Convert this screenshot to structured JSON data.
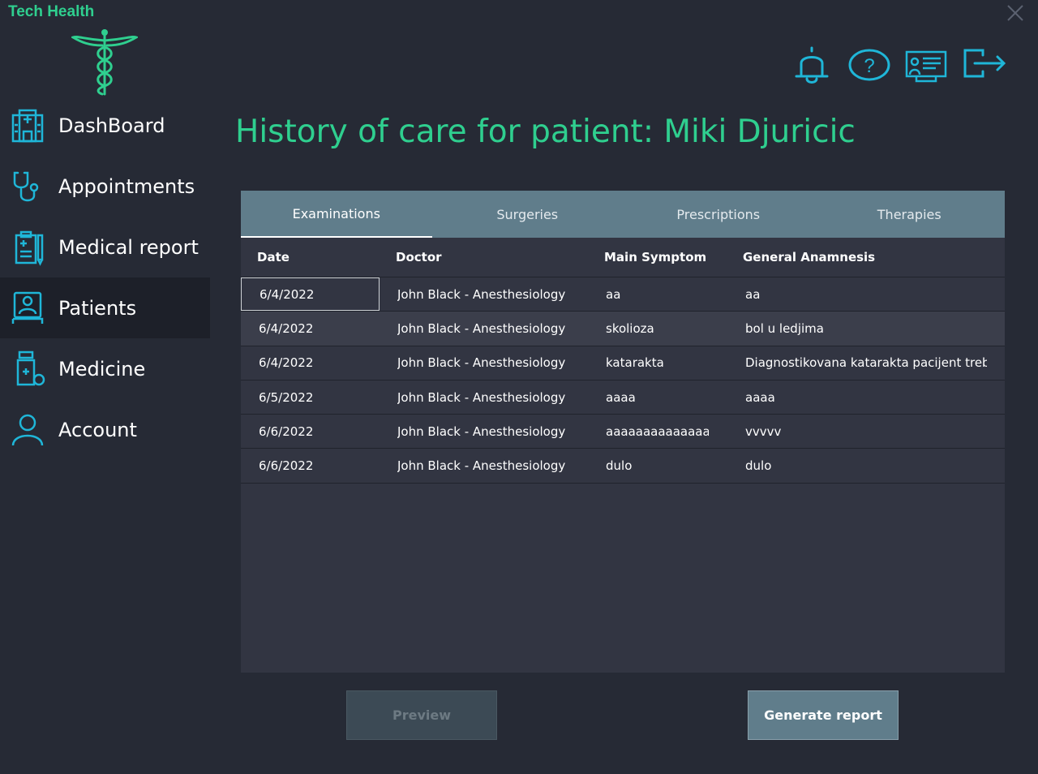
{
  "app": {
    "title": "Tech Health"
  },
  "sidebar": {
    "items": [
      {
        "label": "DashBoard",
        "icon": "hospital-icon",
        "active": false
      },
      {
        "label": "Appointments",
        "icon": "stethoscope-icon",
        "active": false
      },
      {
        "label": "Medical report",
        "icon": "clipboard-icon",
        "active": false
      },
      {
        "label": "Patients",
        "icon": "patient-icon",
        "active": true
      },
      {
        "label": "Medicine",
        "icon": "medicine-bottle-icon",
        "active": false
      },
      {
        "label": "Account",
        "icon": "user-icon",
        "active": false
      }
    ]
  },
  "toolbar": {
    "icons": [
      "bell-icon",
      "help-icon",
      "presentation-icon",
      "logout-icon"
    ]
  },
  "page": {
    "title": "History of care for patient: Miki Djuricic"
  },
  "tabs": [
    {
      "label": "Examinations",
      "active": true
    },
    {
      "label": "Surgeries",
      "active": false
    },
    {
      "label": "Prescriptions",
      "active": false
    },
    {
      "label": "Therapies",
      "active": false
    }
  ],
  "table": {
    "columns": [
      "Date",
      "Doctor",
      "Main Symptom",
      "General Anamnesis"
    ],
    "rows": [
      [
        "6/4/2022",
        "John Black - Anesthesiology",
        "aa",
        "aa"
      ],
      [
        "6/4/2022",
        "John Black - Anesthesiology",
        "skolioza",
        "bol u ledjima"
      ],
      [
        "6/4/2022",
        "John Black - Anesthesiology",
        "katarakta",
        "Diagnostikovana katarakta pacijent treba"
      ],
      [
        "6/5/2022",
        "John Black - Anesthesiology",
        "aaaa",
        "aaaa"
      ],
      [
        "6/6/2022",
        "John Black - Anesthesiology",
        "aaaaaaaaaaaaaaaa",
        "vvvvv"
      ],
      [
        "6/6/2022",
        "John Black - Anesthesiology",
        "dulo",
        "dulo"
      ]
    ]
  },
  "buttons": {
    "preview": "Preview",
    "generate": "Generate report"
  },
  "colors": {
    "accent": "#2fcf8f",
    "icon": "#1fb6d8",
    "tab_bar": "#607d8b",
    "background": "#262a35"
  }
}
